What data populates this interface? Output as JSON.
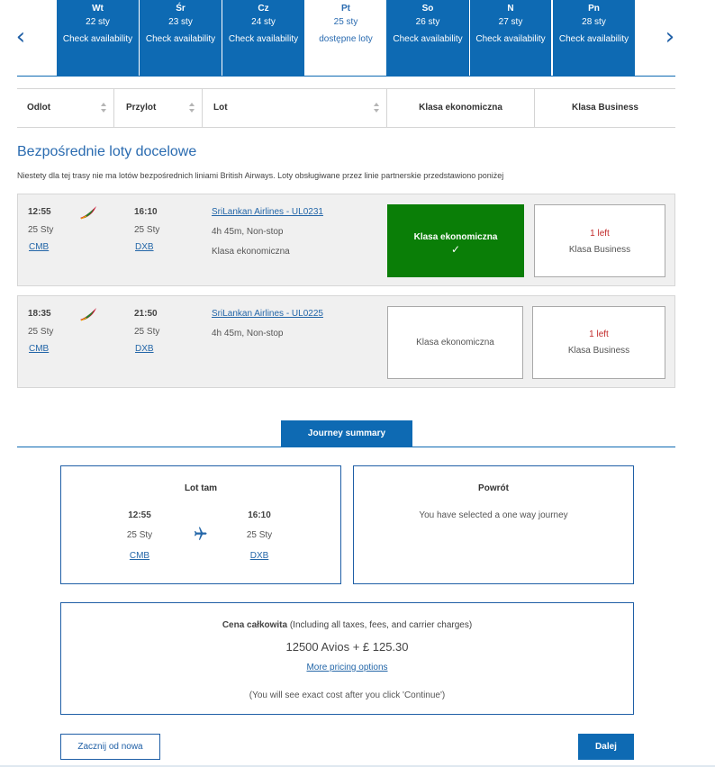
{
  "carousel": {
    "days": [
      {
        "name": "Wt",
        "date": "22 sty",
        "status": "Check availability"
      },
      {
        "name": "Śr",
        "date": "23 sty",
        "status": "Check availability"
      },
      {
        "name": "Cz",
        "date": "24 sty",
        "status": "Check availability"
      },
      {
        "name": "Pt",
        "date": "25 sty",
        "status": "dostępne loty"
      },
      {
        "name": "So",
        "date": "26 sty",
        "status": "Check availability"
      },
      {
        "name": "N",
        "date": "27 sty",
        "status": "Check availability"
      },
      {
        "name": "Pn",
        "date": "28 sty",
        "status": "Check availability"
      }
    ],
    "prev_icon": "chevron-left-icon",
    "next_icon": "chevron-right-icon"
  },
  "table_header": {
    "departure": "Odlot",
    "arrival": "Przylot",
    "flight": "Lot",
    "economy": "Klasa ekonomiczna",
    "business": "Klasa Business"
  },
  "section": {
    "title": "Bezpośrednie loty docelowe",
    "notice": "Niestety dla tej trasy nie ma lotów bezpośrednich liniami British Airways. Loty obsługiwane przez linie partnerskie przedstawiono poniżej"
  },
  "flights": [
    {
      "dep_time": "12:55",
      "dep_date": "25 Sty",
      "dep_code": "CMB",
      "arr_time": "16:10",
      "arr_date": "25 Sty",
      "arr_code": "DXB",
      "airline": "SriLankan Airlines - UL0231",
      "duration": "4h 45m, Non-stop",
      "cabin": "Klasa ekonomiczna",
      "economy_label": "Klasa ekonomiczna",
      "business_left": "1 left",
      "business_label": "Klasa Business"
    },
    {
      "dep_time": "18:35",
      "dep_date": "25 Sty",
      "dep_code": "CMB",
      "arr_time": "21:50",
      "arr_date": "25 Sty",
      "arr_code": "DXB",
      "airline": "SriLankan Airlines - UL0225",
      "duration": "4h 45m, Non-stop",
      "economy_label": "Klasa ekonomiczna",
      "business_left": "1 left",
      "business_label": "Klasa Business"
    }
  ],
  "summary": {
    "tab": "Journey summary",
    "outbound": {
      "title": "Lot tam",
      "dep_time": "12:55",
      "dep_date": "25 Sty",
      "dep_code": "CMB",
      "arr_time": "16:10",
      "arr_date": "25 Sty",
      "arr_code": "DXB"
    },
    "return": {
      "title": "Powrót",
      "text": "You have selected a one way journey"
    },
    "price": {
      "label": "Cena całkowita",
      "note": " (Including all taxes, fees, and carrier charges)",
      "amount": "12500 Avios + £ 125.30",
      "options_link": "More pricing options",
      "disclaimer": "(You will see exact cost after you click 'Continue')"
    }
  },
  "actions": {
    "restart": "Zacznij od nowa",
    "next": "Dalej"
  },
  "colors": {
    "brand_blue": "#0e6ab3",
    "selected_green": "#0a7e07",
    "seats_left_red": "#c22a2a"
  }
}
